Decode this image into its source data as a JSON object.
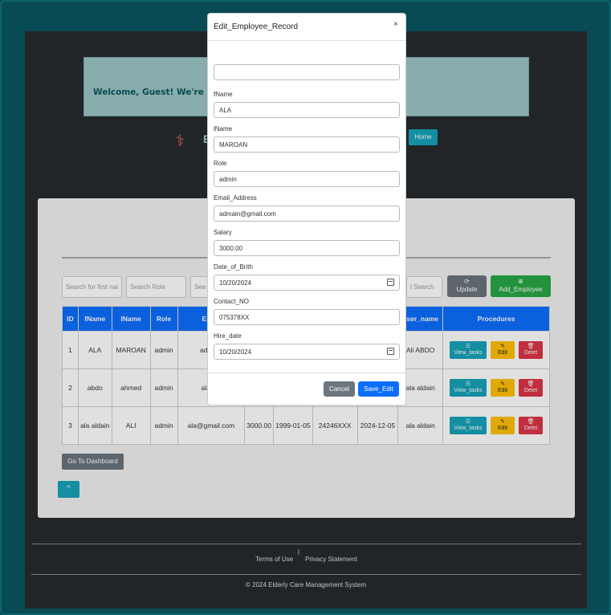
{
  "page": {
    "welcome": "Welcome, Guest! We're glad t",
    "brand": "E",
    "nav_home": "Home",
    "search": [
      "Search for first nai",
      "Search Role",
      "Sea",
      "l Search"
    ],
    "update_label": "Update",
    "add_label": "Add_Employee",
    "table": {
      "headers": [
        "ID",
        "fName",
        "lName",
        "Role",
        "Email",
        "",
        "",
        "",
        "",
        "user_name",
        "Procedures"
      ],
      "rows": [
        [
          "1",
          "ALA",
          "MAROAN",
          "admin",
          "admain",
          "",
          "",
          "",
          "",
          "Ali ABDO"
        ],
        [
          "2",
          "abdo",
          "ahmed",
          "admin",
          "alaa@",
          "",
          "",
          "",
          "",
          "ala aldain"
        ],
        [
          "3",
          "ala aldain",
          "ALI",
          "admin",
          "ala@gmail.com",
          "3000.00",
          "1999-01-05",
          "24246XXX",
          "2024-12-05",
          "ala aldain"
        ]
      ]
    },
    "view_tasks": "View_tasks",
    "edit": "Edit",
    "delete": "Delet",
    "go_dashboard": "Go To Dashboard",
    "footer": {
      "pipe": "|",
      "terms": "Terms of Use",
      "privacy": "Privacy Statement",
      "copyright": "© 2024 Elderly Care Management System"
    }
  },
  "modal": {
    "title": "Edit_Employee_Record",
    "close": "×",
    "top_field_value": "",
    "fields": [
      {
        "label": "fName",
        "value": "ALA"
      },
      {
        "label": "lName",
        "value": "MAROAN"
      },
      {
        "label": "Role",
        "value": "admin"
      },
      {
        "label": "Email_Address",
        "value": "admain@gmail.com"
      },
      {
        "label": "Salary",
        "value": "3000.00"
      },
      {
        "label": "Date_of_Brith",
        "value": "10/20/2024"
      },
      {
        "label": "Contact_NO",
        "value": "075378XX"
      },
      {
        "label": "Hire_date",
        "value": "10/20/2024"
      }
    ],
    "cancel": "Cancel",
    "save": "Save_Edit"
  },
  "icons": {
    "logo": "elderly-care-logo-icon",
    "refresh": "refresh-icon",
    "plus": "plus-circle-icon",
    "list": "list-icon",
    "edit": "edit-icon",
    "trash": "trash-icon",
    "chevron_up": "chevron-up-icon",
    "calendar": "calendar-icon"
  }
}
